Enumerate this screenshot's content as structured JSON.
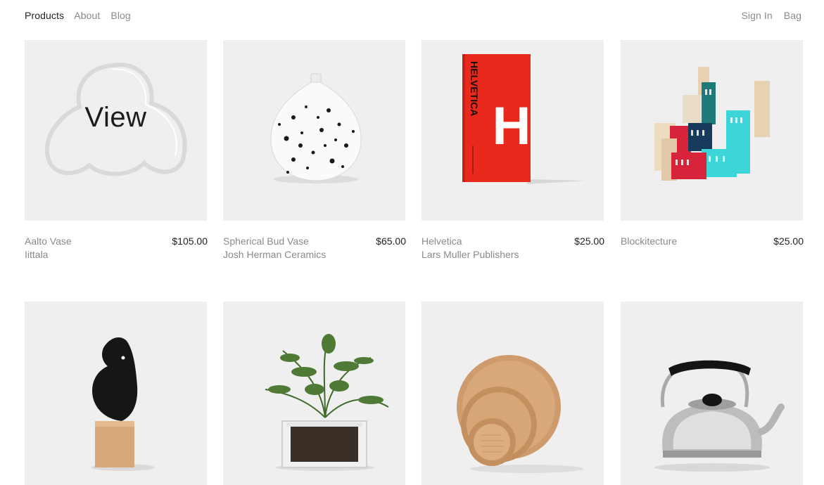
{
  "nav": {
    "left": [
      {
        "label": "Products",
        "active": true
      },
      {
        "label": "About",
        "active": false
      },
      {
        "label": "Blog",
        "active": false
      }
    ],
    "right": [
      {
        "label": "Sign In"
      },
      {
        "label": "Bag"
      }
    ]
  },
  "products": [
    {
      "name": "Aalto Vase",
      "maker": "Iittala",
      "price": "$105.00",
      "hover_label": "View"
    },
    {
      "name": "Spherical Bud Vase",
      "maker": "Josh Herman Ceramics",
      "price": "$65.00"
    },
    {
      "name": "Helvetica",
      "maker": "Lars Muller Publishers",
      "price": "$25.00",
      "cover_text": "HELVETICA",
      "cover_letter": "H"
    },
    {
      "name": "Blockitecture",
      "maker": "",
      "price": "$25.00"
    },
    {
      "name": "Bird",
      "maker": "",
      "price": ""
    },
    {
      "name": "Herb Planter",
      "maker": "",
      "price": ""
    },
    {
      "name": "Wooden Trays",
      "maker": "",
      "price": ""
    },
    {
      "name": "Kettle",
      "maker": "",
      "price": ""
    }
  ],
  "colors": {
    "thumb_bg": "#efefef",
    "text_muted": "#8a8a8a",
    "text_dark": "#222222",
    "book_red": "#e8291c"
  }
}
